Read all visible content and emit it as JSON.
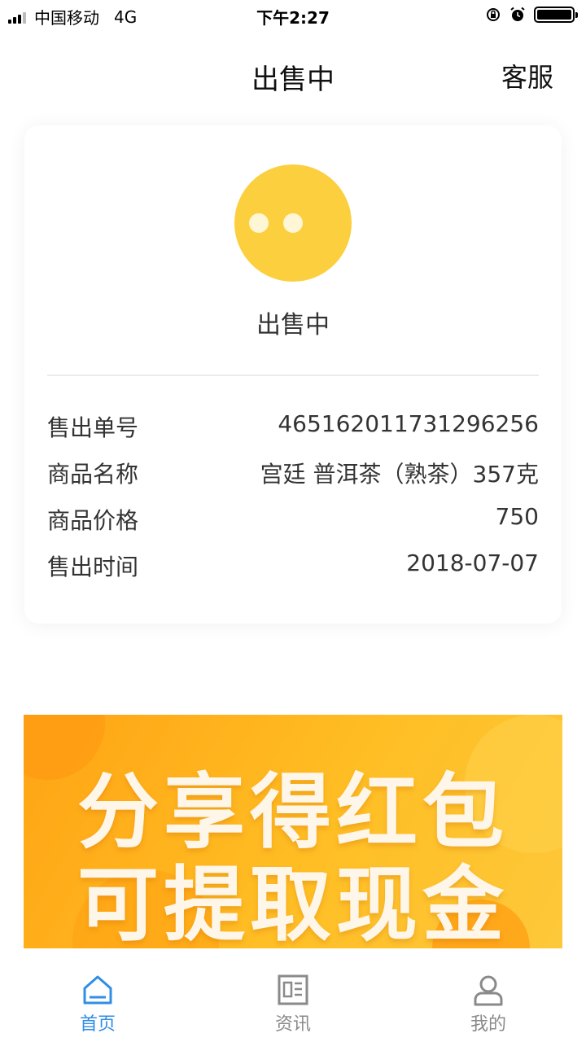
{
  "status_bar": {
    "carrier": "中国移动",
    "network": "4G",
    "time": "下午2:27"
  },
  "header": {
    "title": "出售中",
    "service_label": "客服"
  },
  "order_card": {
    "status_text": "出售中",
    "rows": [
      {
        "label": "售出单号",
        "value": "46516201173129625​6"
      },
      {
        "label": "商品名称",
        "value": "宫廷 普洱茶（熟茶）357克"
      },
      {
        "label": "商品价格",
        "value": "750"
      },
      {
        "label": "售出时间",
        "value": "2018-07-07"
      }
    ]
  },
  "banner": {
    "line1": "分享得红包",
    "line2": "可提取现金"
  },
  "tabbar": {
    "items": [
      {
        "label": "首页",
        "icon": "home-icon",
        "active": true
      },
      {
        "label": "资讯",
        "icon": "news-icon",
        "active": false
      },
      {
        "label": "我的",
        "icon": "user-icon",
        "active": false
      }
    ]
  },
  "colors": {
    "accent": "#2f8ee6",
    "status_icon": "#fccf3e",
    "banner": "#ffb21e"
  }
}
